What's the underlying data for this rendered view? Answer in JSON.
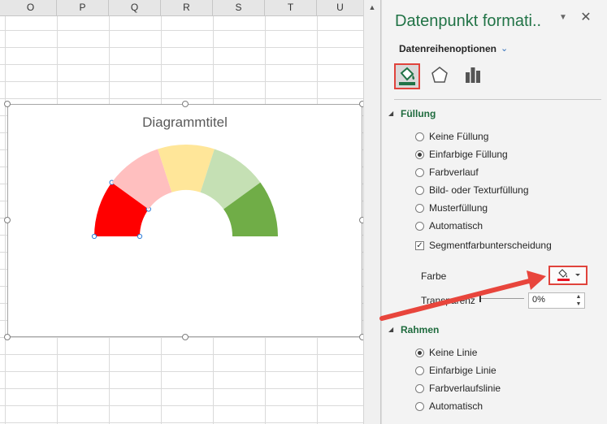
{
  "sheet": {
    "columns": [
      "O",
      "P",
      "Q",
      "R",
      "S",
      "T",
      "U"
    ]
  },
  "chart": {
    "title": "Diagrammtitel",
    "segment_colors": [
      "#ff0000",
      "#ffbfbf",
      "#ffe699",
      "#c5e0b4",
      "#70ad47"
    ],
    "hole_color": "#ffffff"
  },
  "chart_data": {
    "type": "pie",
    "title": "Diagrammtitel",
    "variant": "half-doughnut gauge",
    "values": [
      1,
      1,
      1,
      1,
      1
    ],
    "colors": [
      "#ff0000",
      "#ffbfbf",
      "#ffe699",
      "#c5e0b4",
      "#70ad47"
    ],
    "selected_index": 0
  },
  "pane": {
    "title": "Datenpunkt formati..",
    "series_options": "Datenreihenoptionen",
    "fill_section": {
      "title": "Füllung",
      "options": [
        {
          "label": "Keine Füllung",
          "selected": false
        },
        {
          "label": "Einfarbige Füllung",
          "selected": true
        },
        {
          "label": "Farbverlauf",
          "selected": false
        },
        {
          "label": "Bild- oder Texturfüllung",
          "selected": false
        },
        {
          "label": "Musterfüllung",
          "selected": false
        },
        {
          "label": "Automatisch",
          "selected": false
        }
      ],
      "vary_colors": "Segmentfarbunterscheidung",
      "vary_colors_checked": true,
      "color_label": "Farbe",
      "color_value": "#e81123",
      "transparency_label": "Transparenz",
      "transparency_value": "0%"
    },
    "border_section": {
      "title": "Rahmen",
      "options": [
        {
          "label": "Keine Linie",
          "selected": true
        },
        {
          "label": "Einfarbige Linie",
          "selected": false
        },
        {
          "label": "Farbverlaufslinie",
          "selected": false
        },
        {
          "label": "Automatisch",
          "selected": false
        }
      ]
    }
  },
  "colors": {
    "accent_green": "#217346",
    "highlight_red": "#e0433c",
    "arrow_red": "#e8453c"
  }
}
